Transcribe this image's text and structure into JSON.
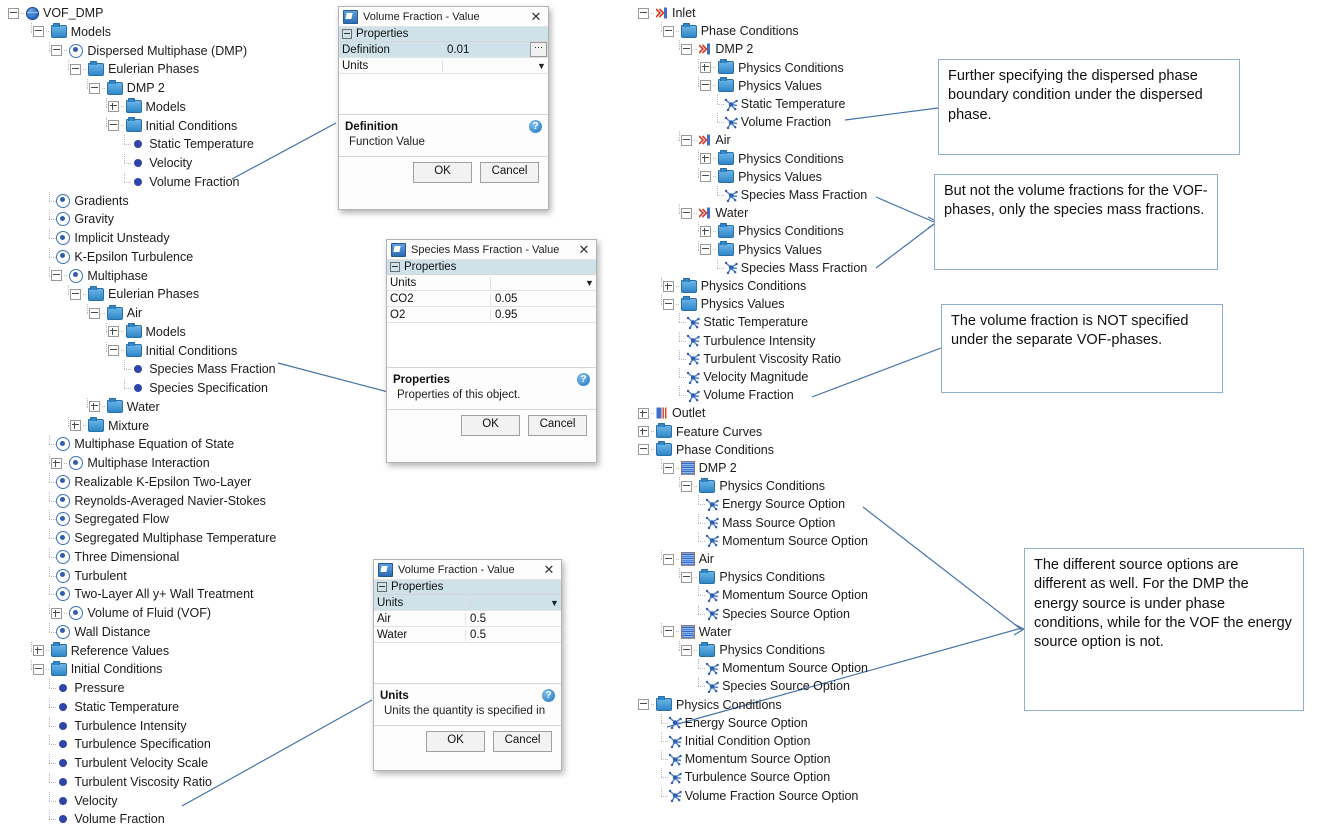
{
  "left_tree": {
    "rows": [
      {
        "label": "VOF_DMP",
        "depth": 0,
        "icon": "globe-icon",
        "exp": "minus"
      },
      {
        "label": "Models",
        "depth": 1,
        "icon": "folder-icon",
        "exp": "minus"
      },
      {
        "label": "Dispersed Multiphase (DMP)",
        "depth": 2,
        "icon": "node-icon",
        "exp": "minus"
      },
      {
        "label": "Eulerian Phases",
        "depth": 3,
        "icon": "folder-icon",
        "exp": "minus"
      },
      {
        "label": "DMP 2",
        "depth": 4,
        "icon": "folder-icon",
        "exp": "minus"
      },
      {
        "label": "Models",
        "depth": 5,
        "icon": "folder-icon",
        "exp": "plus"
      },
      {
        "label": "Initial Conditions",
        "depth": 5,
        "icon": "folder-icon",
        "exp": "minus"
      },
      {
        "label": "Static Temperature",
        "depth": 6,
        "icon": "dot-icon",
        "exp": "none"
      },
      {
        "label": "Velocity",
        "depth": 6,
        "icon": "dot-icon",
        "exp": "none"
      },
      {
        "label": "Volume Fraction",
        "depth": 6,
        "icon": "dot-icon",
        "exp": "none"
      },
      {
        "label": "Gradients",
        "depth": 2,
        "icon": "node-icon",
        "exp": "none"
      },
      {
        "label": "Gravity",
        "depth": 2,
        "icon": "node-icon",
        "exp": "none"
      },
      {
        "label": "Implicit Unsteady",
        "depth": 2,
        "icon": "node-icon",
        "exp": "none"
      },
      {
        "label": "K-Epsilon Turbulence",
        "depth": 2,
        "icon": "node-icon",
        "exp": "none"
      },
      {
        "label": "Multiphase",
        "depth": 2,
        "icon": "node-icon",
        "exp": "minus"
      },
      {
        "label": "Eulerian Phases",
        "depth": 3,
        "icon": "folder-icon",
        "exp": "minus"
      },
      {
        "label": "Air",
        "depth": 4,
        "icon": "folder-icon",
        "exp": "minus"
      },
      {
        "label": "Models",
        "depth": 5,
        "icon": "folder-icon",
        "exp": "plus"
      },
      {
        "label": "Initial Conditions",
        "depth": 5,
        "icon": "folder-icon",
        "exp": "minus"
      },
      {
        "label": "Species Mass Fraction",
        "depth": 6,
        "icon": "dot-icon",
        "exp": "none"
      },
      {
        "label": "Species Specification",
        "depth": 6,
        "icon": "dot-icon",
        "exp": "none"
      },
      {
        "label": "Water",
        "depth": 4,
        "icon": "folder-icon",
        "exp": "plus"
      },
      {
        "label": "Mixture",
        "depth": 3,
        "icon": "folder-icon",
        "exp": "plus"
      },
      {
        "label": "Multiphase Equation of State",
        "depth": 2,
        "icon": "node-icon",
        "exp": "none"
      },
      {
        "label": "Multiphase Interaction",
        "depth": 2,
        "icon": "node-icon",
        "exp": "plus"
      },
      {
        "label": "Realizable K-Epsilon Two-Layer",
        "depth": 2,
        "icon": "node-icon",
        "exp": "none"
      },
      {
        "label": "Reynolds-Averaged Navier-Stokes",
        "depth": 2,
        "icon": "node-icon",
        "exp": "none"
      },
      {
        "label": "Segregated Flow",
        "depth": 2,
        "icon": "node-icon",
        "exp": "none"
      },
      {
        "label": "Segregated Multiphase Temperature",
        "depth": 2,
        "icon": "node-icon",
        "exp": "none"
      },
      {
        "label": "Three Dimensional",
        "depth": 2,
        "icon": "node-icon",
        "exp": "none"
      },
      {
        "label": "Turbulent",
        "depth": 2,
        "icon": "node-icon",
        "exp": "none"
      },
      {
        "label": "Two-Layer All y+ Wall Treatment",
        "depth": 2,
        "icon": "node-icon",
        "exp": "none"
      },
      {
        "label": "Volume of Fluid (VOF)",
        "depth": 2,
        "icon": "node-icon",
        "exp": "plus"
      },
      {
        "label": "Wall Distance",
        "depth": 2,
        "icon": "node-icon",
        "exp": "none"
      },
      {
        "label": "Reference Values",
        "depth": 1,
        "icon": "folder-icon",
        "exp": "plus"
      },
      {
        "label": "Initial Conditions",
        "depth": 1,
        "icon": "folder-icon",
        "exp": "minus"
      },
      {
        "label": "Pressure",
        "depth": 2,
        "icon": "dot-icon",
        "exp": "none"
      },
      {
        "label": "Static Temperature",
        "depth": 2,
        "icon": "dot-icon",
        "exp": "none"
      },
      {
        "label": "Turbulence Intensity",
        "depth": 2,
        "icon": "dot-icon",
        "exp": "none"
      },
      {
        "label": "Turbulence Specification",
        "depth": 2,
        "icon": "dot-icon",
        "exp": "none"
      },
      {
        "label": "Turbulent Velocity Scale",
        "depth": 2,
        "icon": "dot-icon",
        "exp": "none"
      },
      {
        "label": "Turbulent Viscosity Ratio",
        "depth": 2,
        "icon": "dot-icon",
        "exp": "none"
      },
      {
        "label": "Velocity",
        "depth": 2,
        "icon": "dot-icon",
        "exp": "none"
      },
      {
        "label": "Volume Fraction",
        "depth": 2,
        "icon": "dot-icon",
        "exp": "none"
      }
    ]
  },
  "right_tree": {
    "rows": [
      {
        "label": "Inlet",
        "depth": 0,
        "icon": "boundary-icon",
        "exp": "minus"
      },
      {
        "label": "Phase Conditions",
        "depth": 1,
        "icon": "folder-icon",
        "exp": "minus"
      },
      {
        "label": "DMP 2",
        "depth": 2,
        "icon": "boundary-icon",
        "exp": "minus"
      },
      {
        "label": "Physics Conditions",
        "depth": 3,
        "icon": "folder-icon",
        "exp": "plus"
      },
      {
        "label": "Physics Values",
        "depth": 3,
        "icon": "folder-icon",
        "exp": "minus"
      },
      {
        "label": "Static Temperature",
        "depth": 4,
        "icon": "property-icon",
        "exp": "none"
      },
      {
        "label": "Volume Fraction",
        "depth": 4,
        "icon": "property-icon",
        "exp": "none"
      },
      {
        "label": "Air",
        "depth": 2,
        "icon": "boundary-icon",
        "exp": "minus"
      },
      {
        "label": "Physics Conditions",
        "depth": 3,
        "icon": "folder-icon",
        "exp": "plus"
      },
      {
        "label": "Physics Values",
        "depth": 3,
        "icon": "folder-icon",
        "exp": "minus"
      },
      {
        "label": "Species Mass Fraction",
        "depth": 4,
        "icon": "property-icon",
        "exp": "none"
      },
      {
        "label": "Water",
        "depth": 2,
        "icon": "boundary-icon",
        "exp": "minus"
      },
      {
        "label": "Physics Conditions",
        "depth": 3,
        "icon": "folder-icon",
        "exp": "plus"
      },
      {
        "label": "Physics Values",
        "depth": 3,
        "icon": "folder-icon",
        "exp": "minus"
      },
      {
        "label": "Species Mass Fraction",
        "depth": 4,
        "icon": "property-icon",
        "exp": "none"
      },
      {
        "label": "Physics Conditions",
        "depth": 1,
        "icon": "folder-icon",
        "exp": "plus"
      },
      {
        "label": "Physics Values",
        "depth": 1,
        "icon": "folder-icon",
        "exp": "minus"
      },
      {
        "label": "Static Temperature",
        "depth": 2,
        "icon": "property-icon",
        "exp": "none"
      },
      {
        "label": "Turbulence Intensity",
        "depth": 2,
        "icon": "property-icon",
        "exp": "none"
      },
      {
        "label": "Turbulent Viscosity Ratio",
        "depth": 2,
        "icon": "property-icon",
        "exp": "none"
      },
      {
        "label": "Velocity Magnitude",
        "depth": 2,
        "icon": "property-icon",
        "exp": "none"
      },
      {
        "label": "Volume Fraction",
        "depth": 2,
        "icon": "property-icon",
        "exp": "none"
      },
      {
        "label": "Outlet",
        "depth": 0,
        "icon": "outlet-icon",
        "exp": "plus"
      },
      {
        "label": "Feature Curves",
        "depth": 0,
        "icon": "folder-icon",
        "exp": "plus"
      },
      {
        "label": "Phase Conditions",
        "depth": 0,
        "icon": "folder-icon",
        "exp": "minus"
      },
      {
        "label": "DMP 2",
        "depth": 1,
        "icon": "vof-icon",
        "exp": "minus"
      },
      {
        "label": "Physics Conditions",
        "depth": 2,
        "icon": "folder-icon",
        "exp": "minus"
      },
      {
        "label": "Energy Source Option",
        "depth": 3,
        "icon": "property-icon",
        "exp": "none"
      },
      {
        "label": "Mass Source Option",
        "depth": 3,
        "icon": "property-icon",
        "exp": "none"
      },
      {
        "label": "Momentum Source Option",
        "depth": 3,
        "icon": "property-icon",
        "exp": "none"
      },
      {
        "label": "Air",
        "depth": 1,
        "icon": "vof-icon",
        "exp": "minus"
      },
      {
        "label": "Physics Conditions",
        "depth": 2,
        "icon": "folder-icon",
        "exp": "minus"
      },
      {
        "label": "Momentum Source Option",
        "depth": 3,
        "icon": "property-icon",
        "exp": "none"
      },
      {
        "label": "Species Source Option",
        "depth": 3,
        "icon": "property-icon",
        "exp": "none"
      },
      {
        "label": "Water",
        "depth": 1,
        "icon": "vof-icon",
        "exp": "minus"
      },
      {
        "label": "Physics Conditions",
        "depth": 2,
        "icon": "folder-icon",
        "exp": "minus"
      },
      {
        "label": "Momentum Source Option",
        "depth": 3,
        "icon": "property-icon",
        "exp": "none"
      },
      {
        "label": "Species Source Option",
        "depth": 3,
        "icon": "property-icon",
        "exp": "none"
      },
      {
        "label": "Physics Conditions",
        "depth": 0,
        "icon": "folder-icon",
        "exp": "minus"
      },
      {
        "label": "Energy Source Option",
        "depth": 1,
        "icon": "property-icon",
        "exp": "none"
      },
      {
        "label": "Initial Condition Option",
        "depth": 1,
        "icon": "property-icon",
        "exp": "none"
      },
      {
        "label": "Momentum Source Option",
        "depth": 1,
        "icon": "property-icon",
        "exp": "none"
      },
      {
        "label": "Turbulence Source Option",
        "depth": 1,
        "icon": "property-icon",
        "exp": "none"
      },
      {
        "label": "Volume Fraction Source Option",
        "depth": 1,
        "icon": "property-icon",
        "exp": "none"
      }
    ]
  },
  "dialog_vf_dmp": {
    "title": "Volume Fraction - Value",
    "properties_header": "Properties",
    "rows": [
      {
        "key": "Definition",
        "value": "0.01",
        "widget": "ellipsis",
        "selected": true
      },
      {
        "key": "Units",
        "value": "",
        "widget": "dropdown",
        "selected": false
      }
    ],
    "desc_title": "Definition",
    "desc_text": "Function Value",
    "ok": "OK",
    "cancel": "Cancel"
  },
  "dialog_species": {
    "title": "Species Mass Fraction - Value",
    "properties_header": "Properties",
    "rows": [
      {
        "key": "Units",
        "value": "",
        "widget": "dropdown",
        "selected": false
      },
      {
        "key": "CO2",
        "value": "0.05",
        "widget": "none",
        "selected": false
      },
      {
        "key": "O2",
        "value": "0.95",
        "widget": "none",
        "selected": false
      }
    ],
    "desc_title": "Properties",
    "desc_text": "Properties of this object.",
    "ok": "OK",
    "cancel": "Cancel"
  },
  "dialog_vf_vof": {
    "title": "Volume Fraction - Value",
    "properties_header": "Properties",
    "rows": [
      {
        "key": "Units",
        "value": "",
        "widget": "dropdown",
        "selected": true
      },
      {
        "key": "Air",
        "value": "0.5",
        "widget": "none",
        "selected": false
      },
      {
        "key": "Water",
        "value": "0.5",
        "widget": "none",
        "selected": false
      }
    ],
    "desc_title": "Units",
    "desc_text": "Units the quantity is specified in",
    "ok": "OK",
    "cancel": "Cancel"
  },
  "callouts": [
    {
      "text": "Further specifying the dispersed phase boundary condition under the dispersed phase."
    },
    {
      "text": "But not the volume fractions for the VOF-phases, only the species mass fractions."
    },
    {
      "text": "The volume fraction is NOT specified under the separate VOF-phases."
    },
    {
      "text": "The different source options are different as well. For the DMP the energy source is under phase conditions, while for the VOF the energy source option is not."
    }
  ],
  "colors": {
    "accent": "#2f6fc4",
    "callout_border": "#8faecd",
    "selection": "#cfe2ea",
    "leader_line": "#4472a8"
  }
}
